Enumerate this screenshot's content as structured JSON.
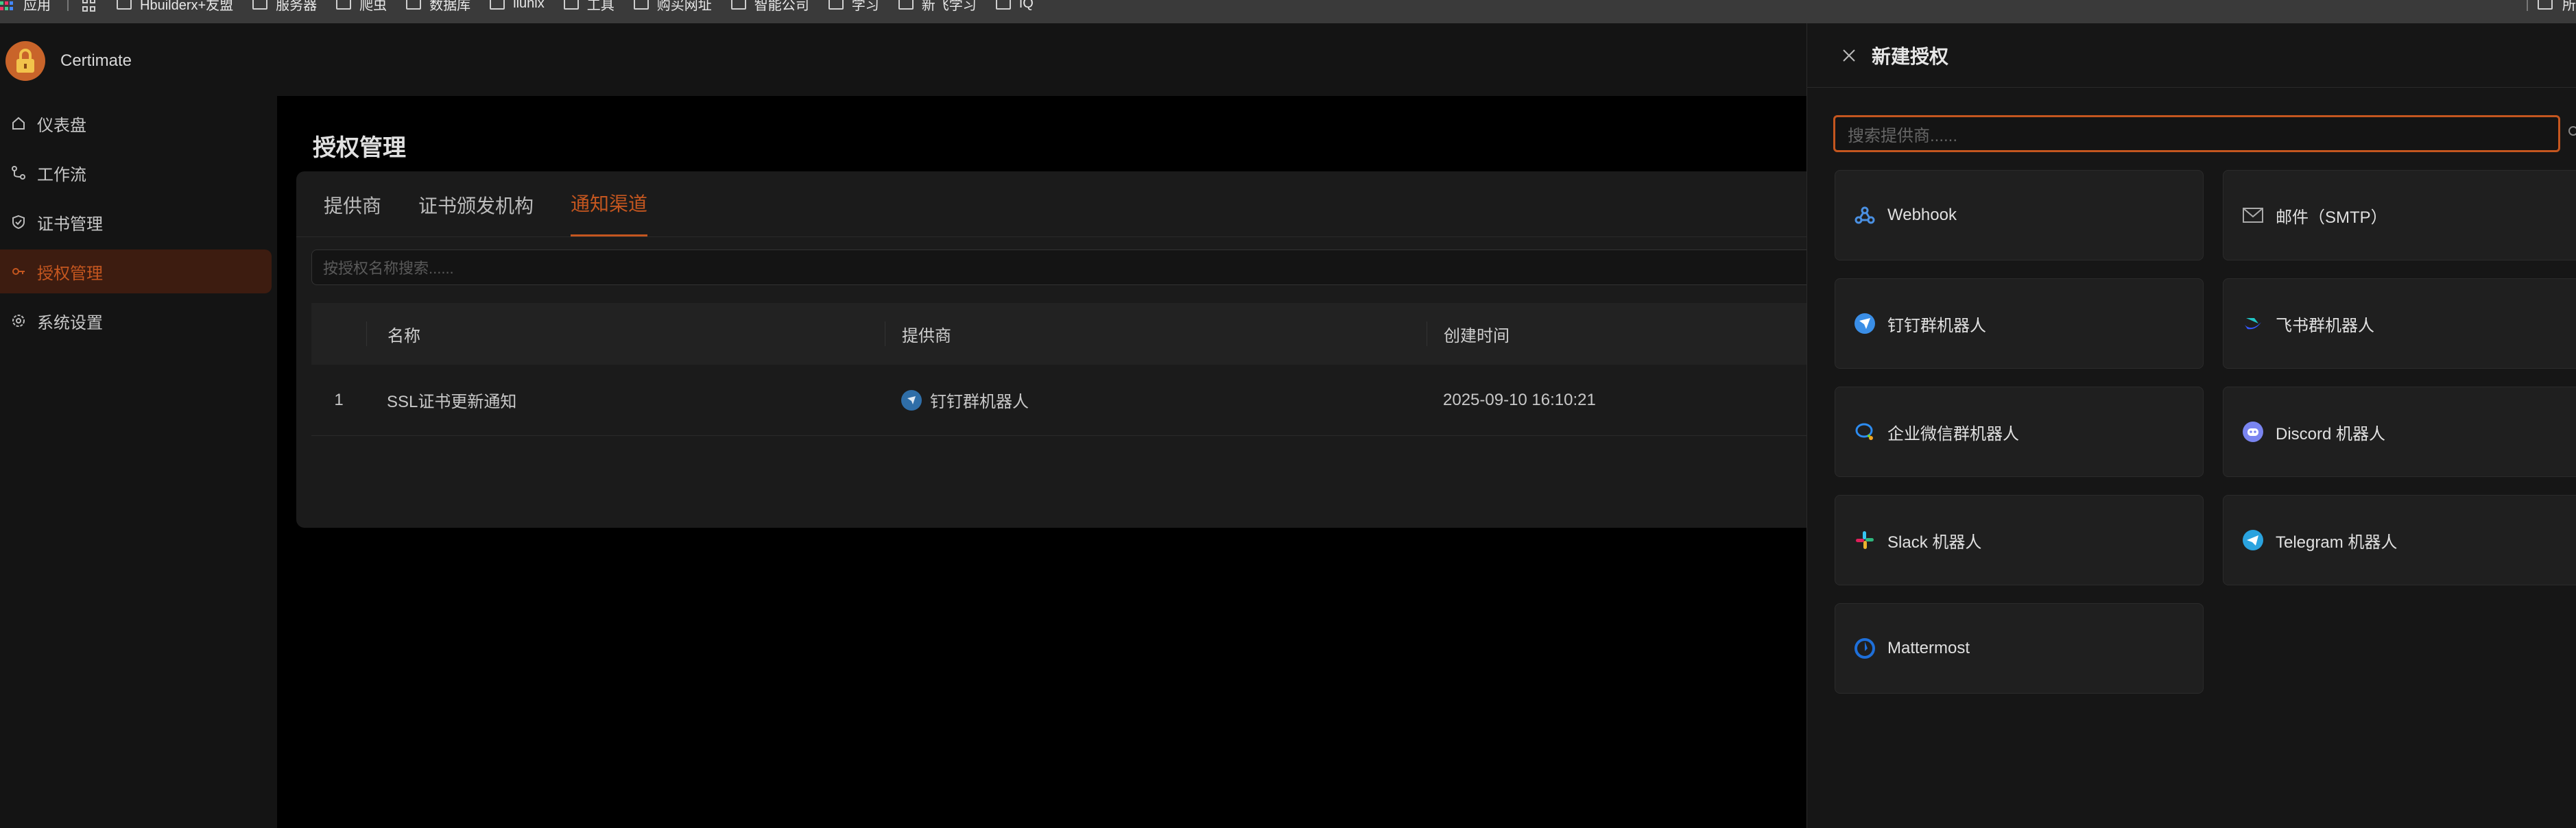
{
  "bookmarks": {
    "items": [
      "应用",
      "Hbuilderx+友盟",
      "服务器",
      "爬虫",
      "数据库",
      "liunix",
      "工具",
      "购买网址",
      "智能公司",
      "学习",
      "新飞学习",
      "IQ"
    ],
    "right_item": "所"
  },
  "sidebar": {
    "brand": "Certimate",
    "items": [
      {
        "label": "仪表盘",
        "icon": "home-icon"
      },
      {
        "label": "工作流",
        "icon": "workflow-icon"
      },
      {
        "label": "证书管理",
        "icon": "shield-icon"
      },
      {
        "label": "授权管理",
        "icon": "key-icon",
        "active": true
      },
      {
        "label": "系统设置",
        "icon": "gear-icon"
      }
    ]
  },
  "main": {
    "title": "授权管理",
    "tabs": [
      {
        "label": "提供商"
      },
      {
        "label": "证书颁发机构"
      },
      {
        "label": "通知渠道",
        "active": true
      }
    ],
    "filter_placeholder": "按授权名称搜索......",
    "table": {
      "headers": [
        "名称",
        "提供商",
        "创建时间"
      ],
      "rows": [
        {
          "index": "1",
          "name": "SSL证书更新通知",
          "provider": "钉钉群机器人",
          "created": "2025-09-10 16:10:21"
        }
      ]
    }
  },
  "drawer": {
    "title": "新建授权",
    "search_placeholder": "搜索提供商......",
    "providers": [
      {
        "label": "Webhook",
        "icon": "webhook-icon"
      },
      {
        "label": "邮件（SMTP）",
        "icon": "mail-icon"
      },
      {
        "label": "钉钉群机器人",
        "icon": "dingtalk-icon"
      },
      {
        "label": "飞书群机器人",
        "icon": "feishu-icon"
      },
      {
        "label": "企业微信群机器人",
        "icon": "wecom-icon"
      },
      {
        "label": "Discord 机器人",
        "icon": "discord-icon"
      },
      {
        "label": "Slack 机器人",
        "icon": "slack-icon"
      },
      {
        "label": "Telegram 机器人",
        "icon": "telegram-icon"
      },
      {
        "label": "Mattermost",
        "icon": "mattermost-icon"
      }
    ]
  },
  "colors": {
    "accent": "#c4561f",
    "sidebar_bg": "#141414",
    "card_bg": "#1b1b1b"
  }
}
